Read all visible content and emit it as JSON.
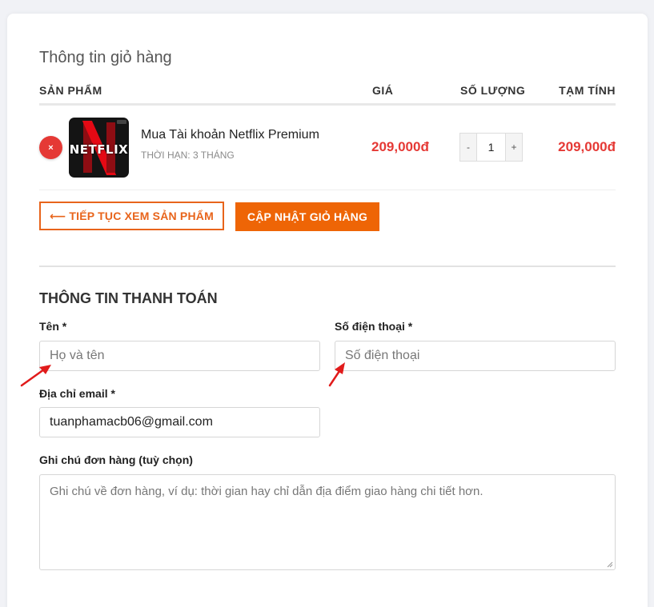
{
  "cart": {
    "title": "Thông tin giỏ hàng",
    "columns": {
      "product": "SẢN PHẨM",
      "price": "GIÁ",
      "quantity": "SỐ LƯỢNG",
      "subtotal": "TẠM TÍNH"
    },
    "item": {
      "remove_symbol": "×",
      "thumbnail_text": "NETFLIX",
      "name": "Mua Tài khoản Netflix Premium",
      "meta": "THỜI HẠN:  3 THÁNG",
      "price": "209,000đ",
      "quantity": "1",
      "minus": "-",
      "plus": "+",
      "subtotal": "209,000đ"
    },
    "continue_button": "⟵ TIẾP TỤC XEM SẢN PHẨM",
    "update_button": "CẬP NHẬT GIỎ HÀNG"
  },
  "billing": {
    "title": "THÔNG TIN THANH TOÁN",
    "name": {
      "label": "Tên *",
      "placeholder": "Họ và tên",
      "value": ""
    },
    "phone": {
      "label": "Số điện thoại *",
      "placeholder": "Số điện thoại",
      "value": ""
    },
    "email": {
      "label": "Địa chỉ email *",
      "value": "tuanphamacb06@gmail.com"
    },
    "notes": {
      "label": "Ghi chú đơn hàng (tuỳ chọn)",
      "placeholder": "Ghi chú về đơn hàng, ví dụ: thời gian hay chỉ dẫn địa điểm giao hàng chi tiết hơn."
    }
  },
  "colors": {
    "accent": "#ee6506",
    "price": "#e53935",
    "annotation_arrow": "#e11b1b"
  },
  "icons": {
    "remove": "close-icon",
    "annotation": "red-arrow-icon"
  }
}
